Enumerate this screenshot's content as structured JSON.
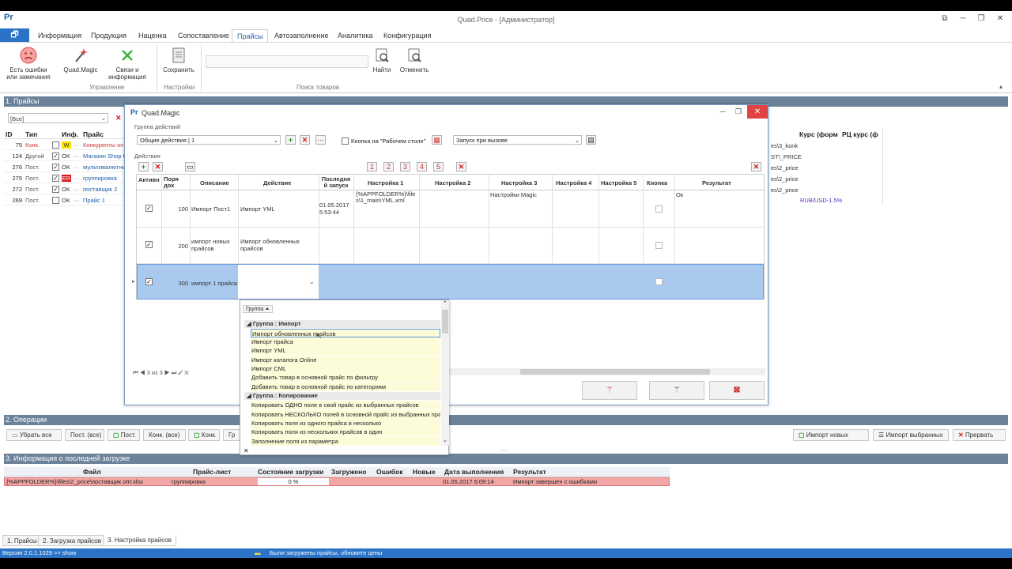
{
  "app": {
    "title": "Quad.Price - [Администратор]",
    "icon_label": "Pr"
  },
  "ribbon_tabs": [
    "Информация",
    "Продукция",
    "Наценка",
    "Сопоставление",
    "Прайсы",
    "Автозаполнение",
    "Аналитика",
    "Конфигурация"
  ],
  "ribbon": {
    "errors_btn": "Есть ошибки\nили замечания",
    "magic_btn": "Quad.Magic",
    "links_btn": "Связи и\nинформация",
    "save_btn": "Сохранить",
    "find_btn": "Найти",
    "cancel_btn": "Отменить",
    "group_manage": "Управление",
    "group_settings": "Настройки",
    "group_search": "Поиск товаров"
  },
  "prices_section": {
    "title": "1. Прайсы",
    "filter_value": "[Все]",
    "headers": [
      "ID",
      "Тип",
      "Инф.",
      "Прайс"
    ],
    "rows": [
      {
        "id": "75",
        "type": "Конк.",
        "checked": false,
        "status": "W",
        "price": "Конкуренты onl"
      },
      {
        "id": "124",
        "type": "Другой",
        "checked": true,
        "status": "OK",
        "price": "Магазин Shop I"
      },
      {
        "id": "276",
        "type": "Пост.",
        "checked": true,
        "status": "OK",
        "price": "мультивалютны"
      },
      {
        "id": "275",
        "type": "Пост.",
        "checked": true,
        "status": "ER",
        "price": "группировка"
      },
      {
        "id": "272",
        "type": "Пост.",
        "checked": true,
        "status": "OK",
        "price": "поставщик 2"
      },
      {
        "id": "269",
        "type": "Пост.",
        "checked": false,
        "status": "OK",
        "price": "Прайс 1"
      }
    ],
    "right_headers": [
      "Курс (форм",
      "РЦ курс (ф"
    ],
    "right_paths": [
      "es\\3_konk",
      "ST\\_PRICE",
      "es\\2_price",
      "es\\2_price",
      "es\\2_price"
    ],
    "rate_value": "RUB/USD-1.5%"
  },
  "dialog": {
    "title": "Quad.Magic",
    "icon_label": "Pr",
    "group_label": "Группа действий",
    "group_select": "Общие действия  |  1",
    "desktop_checkbox": "Кнопка на \"Рабочем столе\"",
    "launch_select": "Запуск при вызове",
    "actions_label": "Действия",
    "num_buttons": [
      "1",
      "2",
      "3",
      "4",
      "5"
    ],
    "headers": [
      "Активн",
      "Поря док",
      "Описание",
      "Действие",
      "Последня й запуск",
      "Настройка 1",
      "Настройка 2",
      "Настройка 3",
      "Настройка 4",
      "Настройка 5",
      "Кнопка",
      "Результат"
    ],
    "rows": [
      {
        "active": true,
        "order": "100",
        "desc": "Импорт Пост1",
        "action": "Импорт YML",
        "last": "01.05.2017 5:53:44",
        "s1": "{%APPFOLDER%}\\files\\1_main\\YML.xml",
        "s3": "Настройки Magic",
        "result": "Ок"
      },
      {
        "active": true,
        "order": "200",
        "desc": "импорт новых прайсов",
        "action": "Импорт обновленных прайсов",
        "last": "",
        "s1": "",
        "s3": "",
        "result": ""
      },
      {
        "active": true,
        "order": "300",
        "desc": "импорт 1 прайса",
        "action": "",
        "last": "",
        "s1": "",
        "s3": "",
        "result": ""
      }
    ],
    "nav_text": "3 из 3"
  },
  "popup": {
    "sort_label": "Группа",
    "groups": [
      {
        "name": "Группа : Импорт",
        "items": [
          "Импорт обновленных прайсов",
          "Импорт прайса",
          "Импорт YML",
          "Импорт каталога Online",
          "Импорт CML",
          "Добавить товар в основной прайс по фильтру",
          "Добавить товар в основной прайс по категориям"
        ]
      },
      {
        "name": "Группа : Копирование",
        "items": [
          "Копировать ОДНО поле в свой прайс из выбранных прайсов",
          "Копировать НЕСКОЛЬКО полей в основной прайс из выбранных прайс",
          "Копировать поля из одного прайса в несколько",
          "Копировать поля из нескольких прайсов в один",
          "Заполнение поля из параметра"
        ]
      }
    ]
  },
  "operations": {
    "title": "2. Операции",
    "buttons": [
      "Убрать все",
      "Пост. (все)",
      "Пост.",
      "Конк. (все)",
      "Конк.",
      "Гр"
    ],
    "right_buttons": [
      "Импорт новых",
      "Импорт выбранных",
      "Прервать"
    ]
  },
  "last_load": {
    "title": "3. Информация о последней загрузке",
    "headers": [
      "Файл",
      "Прайс-лист",
      "Состояние загрузки",
      "Загружено",
      "Ошибок",
      "Новые",
      "Дата выполнения",
      "Результат"
    ],
    "row": {
      "file": "{%APPFOLDER%}\\files\\2_price\\поставщик опт.xlsx",
      "price": "группировка",
      "state": "0 %",
      "loaded": "",
      "errors": "",
      "new": "",
      "date": "01.05.2017 6:09:14",
      "result": "Импорт завершен с ошибками"
    }
  },
  "bottom_tabs": [
    "1. Прайсы",
    "2. Загрузка прайсов",
    "3. Настройка прайсов"
  ],
  "status": {
    "version": "Версия 2.0.1.1029  >> show",
    "message": "Были загружены прайсы, обновите цены"
  },
  "colors": {
    "accent": "#2b73c6",
    "section": "#6b8299",
    "selected_row": "#a9c9ef",
    "error_row": "#f2a6a6",
    "popup_item": "#fdfcd9"
  }
}
